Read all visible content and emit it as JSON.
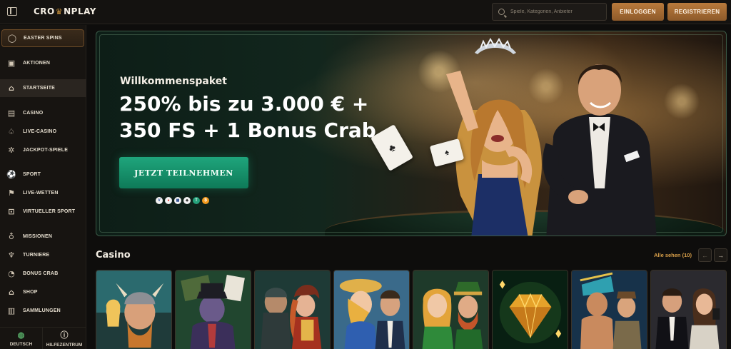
{
  "header": {
    "logo_left": "CRO",
    "logo_right": "NPLAY",
    "search_placeholder": "Spiele, Kategorien, Anbieter",
    "login_label": "EINLOGGEN",
    "register_label": "REGISTRIEREN"
  },
  "sidebar": {
    "items": [
      {
        "label": "EASTER SPINS",
        "icon": "egg-icon"
      },
      {
        "label": "AKTIONEN",
        "icon": "gift-icon"
      },
      {
        "label": "STARTSEITE",
        "icon": "home-icon"
      },
      {
        "label": "CASINO",
        "icon": "slot-machine-icon"
      },
      {
        "label": "LIVE-CASINO",
        "icon": "spade-icon"
      },
      {
        "label": "JACKPOT-SPIELE",
        "icon": "jackpot-icon"
      },
      {
        "label": "SPORT",
        "icon": "football-icon"
      },
      {
        "label": "LIVE-WETTEN",
        "icon": "live-bets-icon"
      },
      {
        "label": "VIRTUELLER SPORT",
        "icon": "gamepad-icon"
      },
      {
        "label": "MISSIONEN",
        "icon": "medal-icon"
      },
      {
        "label": "TURNIERE",
        "icon": "trophy-icon"
      },
      {
        "label": "BONUS CRAB",
        "icon": "crab-icon"
      },
      {
        "label": "SHOP",
        "icon": "shop-icon"
      },
      {
        "label": "SAMMLUNGEN",
        "icon": "collections-icon"
      }
    ],
    "footer": {
      "language_label": "DEUTSCH",
      "help_label": "HILFEZENTRUM"
    }
  },
  "hero": {
    "subtitle": "Willkommenspaket",
    "title_line1": "250% bis zu 3.000 € +",
    "title_line2": "350 FS + 1 Bonus Crab",
    "cta_label": "JETZT TEILNEHMEN",
    "payment_icons": [
      "visa-icon",
      "mastercard-icon",
      "bank-icon",
      "ethereum-icon",
      "tether-icon",
      "bitcoin-icon"
    ]
  },
  "casino": {
    "title": "Casino",
    "see_all": "Alle sehen (10)",
    "games": [
      "viking-slot",
      "gangster-slot",
      "pirate-slot",
      "carnival-slot",
      "lady-slot",
      "leprechaun-slot",
      "diamond-slot",
      "aztec-slot",
      "card-dealer-slot"
    ]
  },
  "colors": {
    "accent": "#d59a3f",
    "button": "#a86d34",
    "cta": "#1a9670",
    "background": "#0e0d0c"
  }
}
